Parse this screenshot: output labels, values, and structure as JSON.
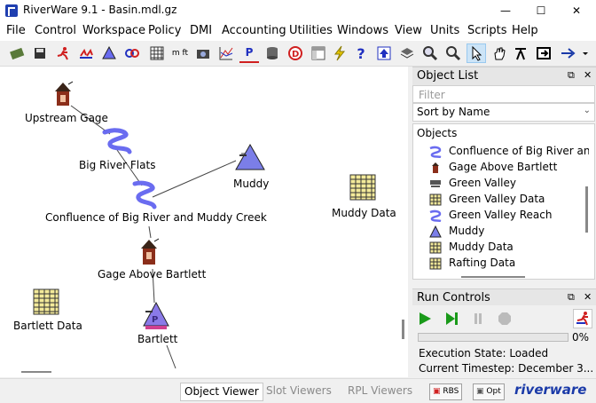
{
  "window": {
    "title": "RiverWare 9.1 - Basin.mdl.gz",
    "minimize": "—",
    "maximize": "☐",
    "close": "✕"
  },
  "menu": [
    "File",
    "Control",
    "Workspace",
    "Policy",
    "DMI",
    "Accounting",
    "Utilities",
    "Windows",
    "View",
    "Units",
    "Scripts",
    "Help"
  ],
  "toolbar": {
    "icons": [
      "open-workspace-icon",
      "save-icon",
      "run-simulation-icon",
      "multiple-run-icon",
      "triangle-object-icon",
      "accounting-icon",
      "grid-icon",
      "units-icon",
      "camera-icon",
      "plot-icon",
      "policy-icon",
      "database-icon",
      "dmi-icon",
      "layout-icon",
      "lightning-icon",
      "help-icon",
      "up-icon",
      "layers-icon",
      "zoom-in-icon",
      "zoom-out-icon",
      "pointer-icon",
      "pan-hand-icon",
      "easel-icon",
      "export-icon",
      "arrow-icon"
    ],
    "units_label": "m ft",
    "policy_label": "P",
    "dmi_label": "D"
  },
  "canvas": {
    "objects": [
      {
        "name": "upstream-gage",
        "label": "Upstream Gage"
      },
      {
        "name": "big-river-flats",
        "label": "Big River Flats"
      },
      {
        "name": "muddy",
        "label": "Muddy"
      },
      {
        "name": "muddy-data",
        "label": "Muddy Data"
      },
      {
        "name": "confluence",
        "label": "Confluence of Big River and Muddy Creek"
      },
      {
        "name": "gage-above-bartlett",
        "label": "Gage Above Bartlett"
      },
      {
        "name": "bartlett-data",
        "label": "Bartlett Data"
      },
      {
        "name": "bartlett",
        "label": "Bartlett"
      }
    ],
    "bartlett_mark": "P"
  },
  "object_list": {
    "title": "Object List",
    "filter_placeholder": "Filter",
    "sort_value": "Sort by Name",
    "header": "Objects",
    "items": [
      {
        "label": "Confluence of Big River an",
        "icon": "reach-icon"
      },
      {
        "label": "Gage Above Bartlett",
        "icon": "gage-icon"
      },
      {
        "label": "Green Valley",
        "icon": "thermal-icon"
      },
      {
        "label": "Green Valley Data",
        "icon": "data-object-icon"
      },
      {
        "label": "Green Valley Reach",
        "icon": "reach-icon"
      },
      {
        "label": "Muddy",
        "icon": "reservoir-icon"
      },
      {
        "label": "Muddy Data",
        "icon": "data-object-icon"
      },
      {
        "label": "Rafting Data",
        "icon": "data-object-icon"
      }
    ]
  },
  "run_controls": {
    "title": "Run Controls",
    "progress_percent": 0,
    "progress_text": "0%",
    "execution_state": "Execution State: Loaded",
    "current_timestep": "Current Timestep: December 3..."
  },
  "status_bar": {
    "object_viewer": "Object Viewer",
    "slot_viewers": "Slot Viewers",
    "rpl_viewers": "RPL Viewers",
    "rbs_badge": "RBS",
    "opt_badge": "Opt",
    "brand": "riverware"
  },
  "colors": {
    "reach": "#6a6cf0",
    "reservoir": "#7b7ee8",
    "gage": "#8b2e1a",
    "data": "#f3ea9a",
    "play": "#1a9a1a"
  }
}
